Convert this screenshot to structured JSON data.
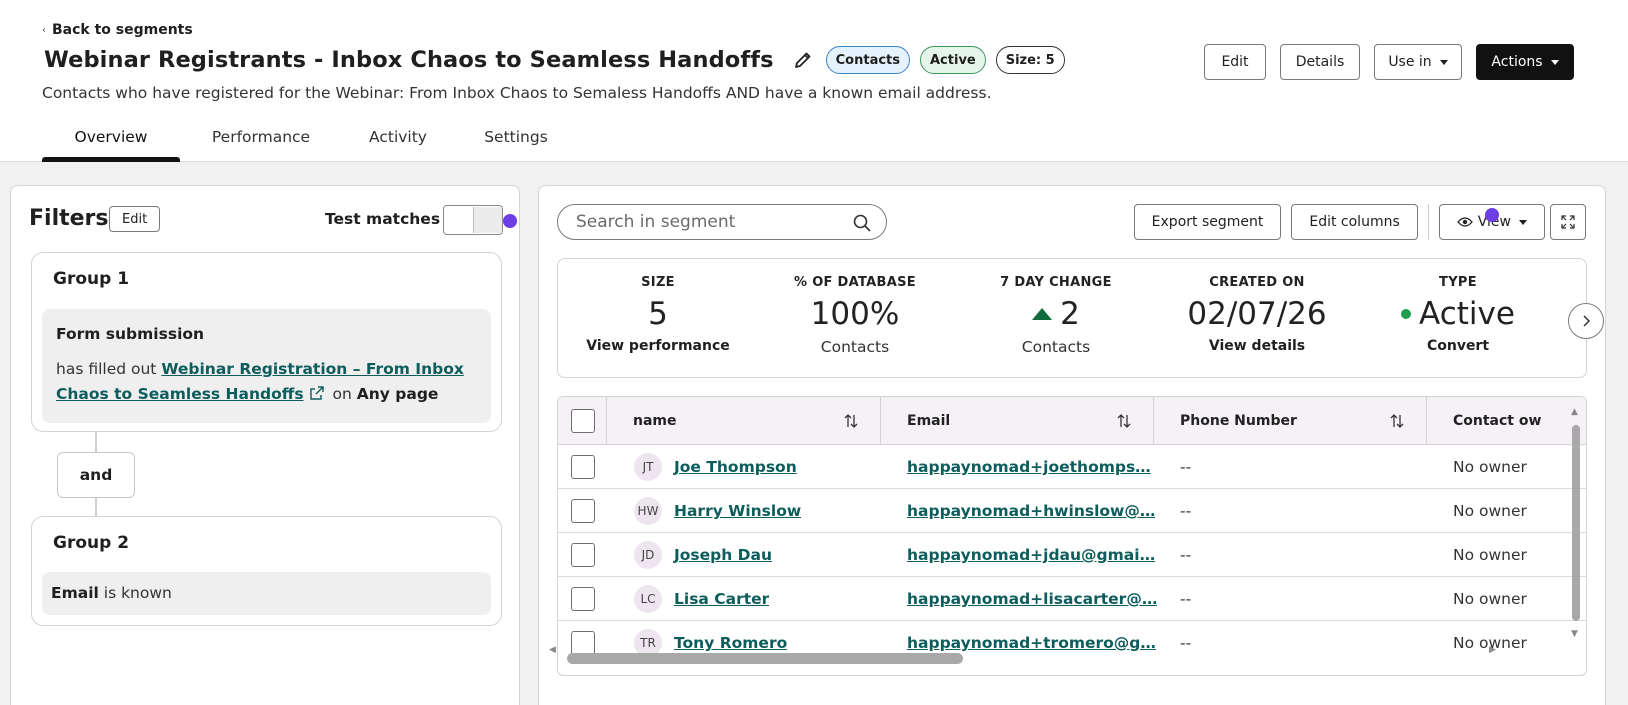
{
  "header": {
    "back_label": "Back to segments",
    "title": "Webinar Registrants - Inbox Chaos to Seamless Handoffs",
    "badges": {
      "contacts": "Contacts",
      "active": "Active",
      "size": "Size: 5"
    },
    "subtitle": "Contacts who have registered for the Webinar: From Inbox Chaos to Semaless Handoffs AND have a known email address.",
    "buttons": {
      "edit": "Edit",
      "details": "Details",
      "use_in": "Use in",
      "actions": "Actions"
    },
    "tabs": [
      "Overview",
      "Performance",
      "Activity",
      "Settings"
    ]
  },
  "filters": {
    "title": "Filters",
    "edit_label": "Edit",
    "test_matches_label": "Test matches",
    "group1": {
      "title": "Group 1",
      "filter_title": "Form submission",
      "prefix": "has filled out",
      "form_link": "Webinar Registration – From Inbox Chaos to Seamless Handoffs",
      "on_text": "on",
      "page_text": "Any page"
    },
    "and_label": "and",
    "group2": {
      "title": "Group 2",
      "property": "Email",
      "condition": "is known"
    }
  },
  "toolbar": {
    "search_placeholder": "Search in segment",
    "export_label": "Export segment",
    "edit_columns_label": "Edit columns",
    "view_label": "View"
  },
  "stats": [
    {
      "label": "SIZE",
      "value": "5",
      "sub": "View performance"
    },
    {
      "label": "% OF DATABASE",
      "value": "100%",
      "sub": "Contacts"
    },
    {
      "label": "7 DAY CHANGE",
      "value": "2",
      "sub": "Contacts"
    },
    {
      "label": "CREATED ON",
      "value": "02/07/26",
      "sub": "View details"
    },
    {
      "label": "TYPE",
      "value": "Active",
      "sub": "Convert"
    }
  ],
  "table": {
    "columns": [
      "name",
      "Email",
      "Phone Number",
      "Contact ow"
    ],
    "rows": [
      {
        "initials": "JT",
        "name": "Joe Thompson",
        "email": "happaynomad+joethomps…",
        "phone": "--",
        "owner": "No owner"
      },
      {
        "initials": "HW",
        "name": "Harry Winslow",
        "email": "happaynomad+hwinslow@…",
        "phone": "--",
        "owner": "No owner"
      },
      {
        "initials": "JD",
        "name": "Joseph Dau",
        "email": "happaynomad+jdau@gmai…",
        "phone": "--",
        "owner": "No owner"
      },
      {
        "initials": "LC",
        "name": "Lisa Carter",
        "email": "happaynomad+lisacarter@…",
        "phone": "--",
        "owner": "No owner"
      },
      {
        "initials": "TR",
        "name": "Tony Romero",
        "email": "happaynomad+tromero@g…",
        "phone": "--",
        "owner": "No owner"
      }
    ]
  },
  "colors": {
    "accent_purple": "#6b3ee6",
    "link_teal": "#0c5d5c",
    "success_green": "#1e9e4e",
    "header_bg": "#f5f1f7"
  },
  "icons": [
    "chevron-left-icon",
    "pencil-icon",
    "caret-down-icon",
    "search-icon",
    "eye-icon",
    "expand-icon",
    "external-link-icon",
    "sort-icon",
    "triangle-up-icon",
    "chevron-right-icon"
  ]
}
